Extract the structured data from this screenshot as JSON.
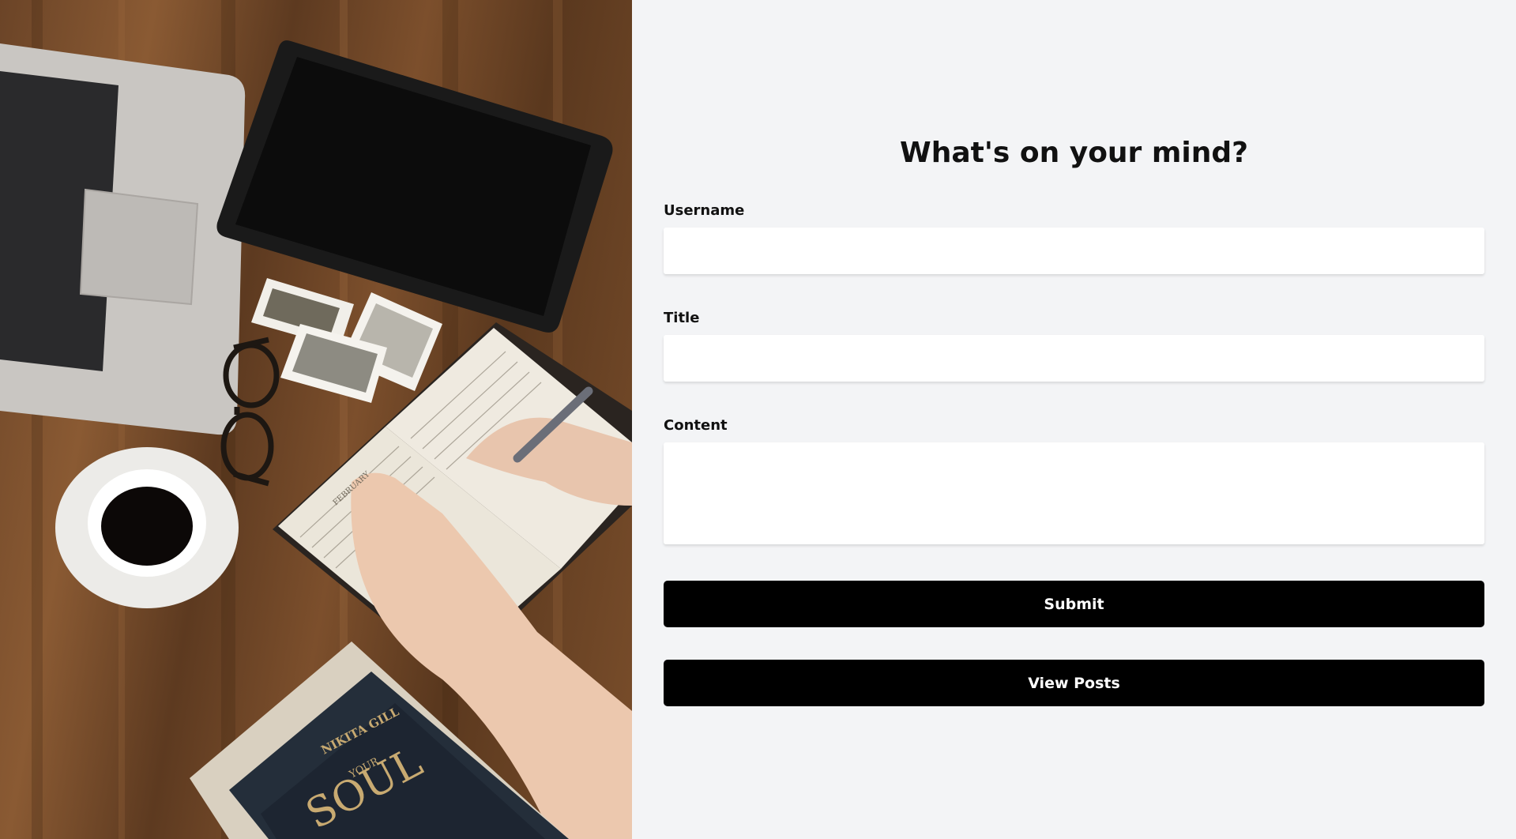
{
  "form": {
    "heading": "What's on your mind?",
    "username_label": "Username",
    "username_value": "",
    "title_label": "Title",
    "title_value": "",
    "content_label": "Content",
    "content_value": "",
    "submit_label": "Submit",
    "view_posts_label": "View Posts"
  },
  "hero_image": {
    "book_cover_author": "NIKITA GILL",
    "book_cover_word1": "YOUR",
    "book_cover_word2": "SOUL",
    "notebook_month": "FEBRUARY"
  },
  "colors": {
    "page_background": "#f3f4f6",
    "button_background": "#000000",
    "button_text": "#ffffff",
    "input_background": "#ffffff"
  }
}
